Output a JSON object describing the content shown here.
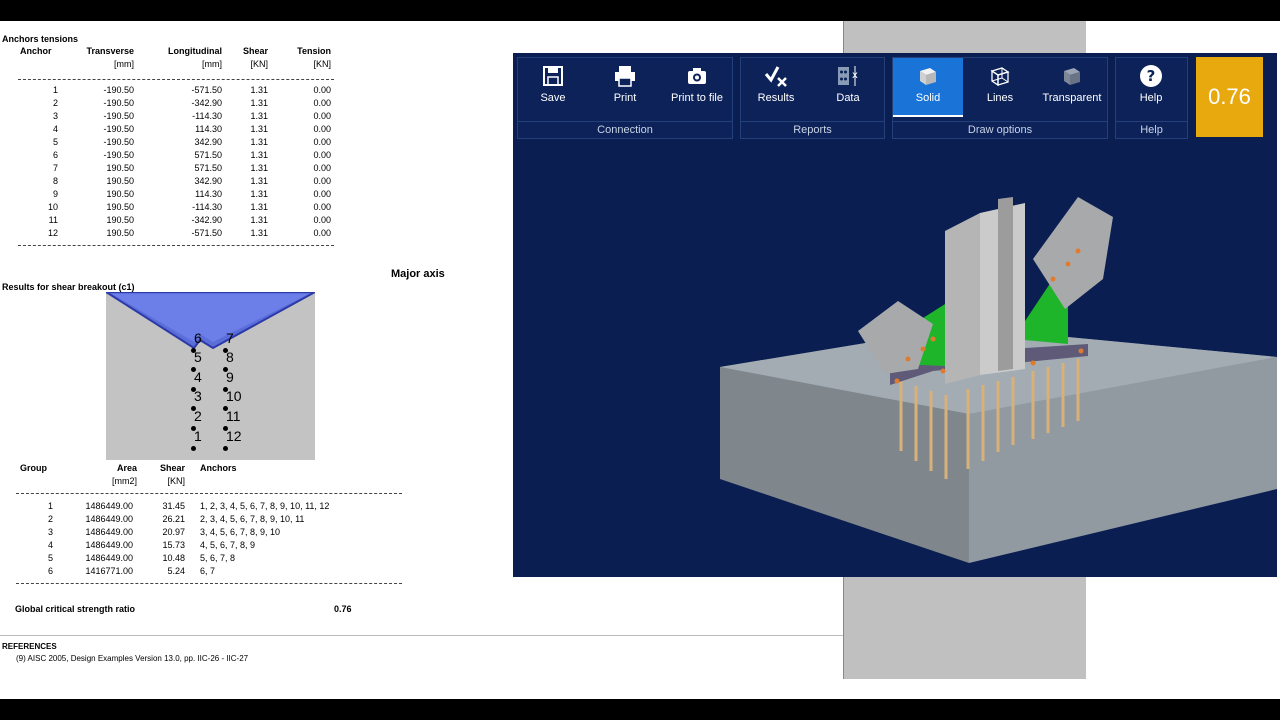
{
  "report": {
    "anchors_title": "Anchors tensions",
    "anchors_headers": [
      "Anchor",
      "Transverse",
      "Longitudinal",
      "Shear",
      "Tension"
    ],
    "anchors_units": [
      "",
      "[mm]",
      "[mm]",
      "[KN]",
      "[KN]"
    ],
    "anchors_rows": [
      [
        "1",
        "-190.50",
        "-571.50",
        "1.31",
        "0.00"
      ],
      [
        "2",
        "-190.50",
        "-342.90",
        "1.31",
        "0.00"
      ],
      [
        "3",
        "-190.50",
        "-114.30",
        "1.31",
        "0.00"
      ],
      [
        "4",
        "-190.50",
        "114.30",
        "1.31",
        "0.00"
      ],
      [
        "5",
        "-190.50",
        "342.90",
        "1.31",
        "0.00"
      ],
      [
        "6",
        "-190.50",
        "571.50",
        "1.31",
        "0.00"
      ],
      [
        "7",
        "190.50",
        "571.50",
        "1.31",
        "0.00"
      ],
      [
        "8",
        "190.50",
        "342.90",
        "1.31",
        "0.00"
      ],
      [
        "9",
        "190.50",
        "114.30",
        "1.31",
        "0.00"
      ],
      [
        "10",
        "190.50",
        "-114.30",
        "1.31",
        "0.00"
      ],
      [
        "11",
        "190.50",
        "-342.90",
        "1.31",
        "0.00"
      ],
      [
        "12",
        "190.50",
        "-571.50",
        "1.31",
        "0.00"
      ]
    ],
    "major_axis": "Major axis",
    "shear_title": "Results for shear breakout (c1)",
    "diagram_labels_left": [
      "6",
      "5",
      "4",
      "3",
      "2",
      "1"
    ],
    "diagram_labels_right": [
      "7",
      "8",
      "9",
      "10",
      "11",
      "12"
    ],
    "group_headers": [
      "Group",
      "Area",
      "Shear",
      "Anchors"
    ],
    "group_units": [
      "",
      "[mm2]",
      "[KN]",
      ""
    ],
    "group_rows": [
      [
        "1",
        "1486449.00",
        "31.45",
        "1, 2, 3, 4, 5, 6, 7, 8, 9, 10, 11, 12"
      ],
      [
        "2",
        "1486449.00",
        "26.21",
        "2, 3, 4, 5, 6, 7, 8, 9, 10, 11"
      ],
      [
        "3",
        "1486449.00",
        "20.97",
        "3, 4, 5, 6, 7, 8, 9, 10"
      ],
      [
        "4",
        "1486449.00",
        "15.73",
        "4, 5, 6, 7, 8, 9"
      ],
      [
        "5",
        "1486449.00",
        "10.48",
        "5, 6, 7, 8"
      ],
      [
        "6",
        "1416771.00",
        "5.24",
        "6, 7"
      ]
    ],
    "global_label": "Global critical strength ratio",
    "global_value": "0.76",
    "references_title": "REFERENCES",
    "reference_text": "(9) AISC 2005, Design Examples Version 13.0, pp. IIC-26 - IIC-27"
  },
  "ribbon": {
    "save": "Save",
    "print": "Print",
    "print_to_file": "Print to file",
    "group_connection": "Connection",
    "results": "Results",
    "data": "Data",
    "group_reports": "Reports",
    "solid": "Solid",
    "lines": "Lines",
    "transparent": "Transparent",
    "group_draw": "Draw options",
    "help": "Help",
    "group_help": "Help",
    "ratio": "0.76"
  },
  "colors": {
    "ribbon_bg": "#0c2258",
    "active": "#1a74d8",
    "ratio_badge": "#e8a90f",
    "viewport_bg": "#0a1e52"
  },
  "icons": [
    "save-icon",
    "print-icon",
    "camera-icon",
    "check-x-icon",
    "data-icon",
    "cube-solid-icon",
    "cube-wire-icon",
    "cube-transparent-icon",
    "help-icon"
  ]
}
